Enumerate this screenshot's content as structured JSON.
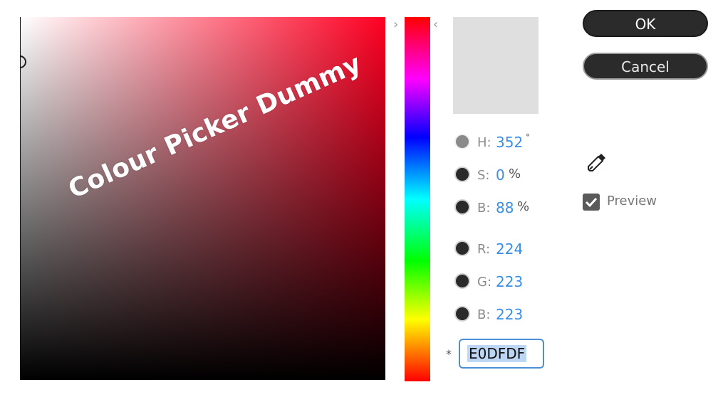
{
  "watermark": "Colour Picker Dummy",
  "buttons": {
    "ok": "OK",
    "cancel": "Cancel"
  },
  "selected_color": {
    "hex": "E0DFDF",
    "swatch": "#e0dfdf"
  },
  "fields": [
    {
      "key": "hue",
      "label": "H:",
      "value": "352",
      "unit": "°"
    },
    {
      "key": "saturation",
      "label": "S:",
      "value": "0",
      "unit": "%"
    },
    {
      "key": "brightness",
      "label": "B:",
      "value": "88",
      "unit": "%"
    },
    {
      "key": "red",
      "label": "R:",
      "value": "224",
      "unit": ""
    },
    {
      "key": "green",
      "label": "G:",
      "value": "223",
      "unit": ""
    },
    {
      "key": "blue",
      "label": "B:",
      "value": "223",
      "unit": ""
    }
  ],
  "hex_marker": "*",
  "preview": {
    "label": "Preview",
    "checked": true
  },
  "icons": {
    "eyedropper": "eyedropper-icon",
    "checkmark": "checkmark-icon"
  },
  "colors": {
    "accent": "#3a8ee6",
    "hue_base": "#ff0022"
  }
}
